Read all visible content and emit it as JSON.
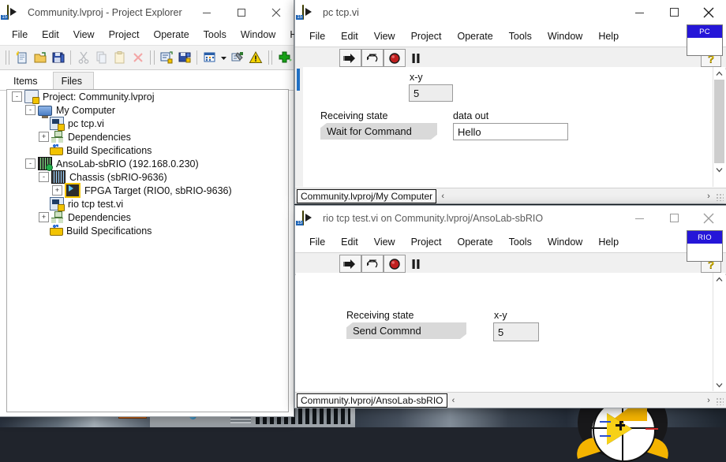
{
  "desktop": {
    "logo_name": "labview-tux-logo"
  },
  "project_explorer": {
    "title": "Community.lvproj - Project Explorer",
    "app_icon": "labview-project-icon",
    "window_buttons": {
      "minimize": "minimize-icon",
      "maximize": "maximize-icon",
      "close": "close-icon"
    },
    "menu": [
      "File",
      "Edit",
      "View",
      "Project",
      "Operate",
      "Tools",
      "Window",
      "Help"
    ],
    "toolbar_icons": [
      "new-vi-icon",
      "open-project-icon",
      "save-all-icon",
      "cut-icon",
      "copy-icon",
      "paste-icon",
      "delete-icon",
      "show-block-diagram-icon",
      "save-changed-icon",
      "view-options-icon",
      "view-options-dropdown-icon",
      "resolve-conflicts-icon",
      "warning-icon",
      "add-item-icon"
    ],
    "tabs": [
      {
        "label": "Items",
        "active": true
      },
      {
        "label": "Files",
        "active": false
      }
    ],
    "tree": [
      {
        "label": "Project: Community.lvproj",
        "depth": 0,
        "expander": "-",
        "icon": "project-icon"
      },
      {
        "label": "My Computer",
        "depth": 1,
        "expander": "-",
        "icon": "my-computer-icon"
      },
      {
        "label": "pc tcp.vi",
        "depth": 2,
        "expander": "",
        "icon": "vi-icon"
      },
      {
        "label": "Dependencies",
        "depth": 2,
        "expander": "+",
        "icon": "dependencies-icon"
      },
      {
        "label": "Build Specifications",
        "depth": 2,
        "expander": "",
        "icon": "build-specifications-icon"
      },
      {
        "label": "AnsoLab-sbRIO (192.168.0.230)",
        "depth": 1,
        "expander": "-",
        "icon": "rio-target-icon"
      },
      {
        "label": "Chassis (sbRIO-9636)",
        "depth": 2,
        "expander": "-",
        "icon": "chassis-icon"
      },
      {
        "label": "FPGA Target (RIO0, sbRIO-9636)",
        "depth": 3,
        "expander": "+",
        "icon": "fpga-target-icon"
      },
      {
        "label": "rio tcp test.vi",
        "depth": 2,
        "expander": "",
        "icon": "vi-icon"
      },
      {
        "label": "Dependencies",
        "depth": 2,
        "expander": "+",
        "icon": "dependencies-icon"
      },
      {
        "label": "Build Specifications",
        "depth": 2,
        "expander": "",
        "icon": "build-specifications-icon"
      }
    ]
  },
  "pc_vi": {
    "title": "pc tcp.vi",
    "app_icon": "labview-vi-icon",
    "active": true,
    "menu": [
      "File",
      "Edit",
      "View",
      "Project",
      "Operate",
      "Tools",
      "Window",
      "Help"
    ],
    "toolbar": {
      "run_icon": "run-arrow-icon",
      "run_continuously_icon": "run-continuously-icon",
      "abort_icon": "abort-execution-icon",
      "pause_icon": "pause-icon",
      "help_icon": "context-help-icon"
    },
    "badge": {
      "label": "PC",
      "color": "#2516d8"
    },
    "controls": {
      "xy_label": "x-y",
      "xy_value": "5",
      "state_label": "Receiving state",
      "state_value": "Wait for Command",
      "dataout_label": "data out",
      "dataout_value": "Hello"
    },
    "status_path": "Community.lvproj/My Computer",
    "scroll_left_icon": "scroll-left-icon",
    "scroll_right_icon": "scroll-right-icon"
  },
  "rio_vi": {
    "title": "rio tcp test.vi on Community.lvproj/AnsoLab-sbRIO",
    "app_icon": "labview-vi-icon",
    "active": false,
    "menu": [
      "File",
      "Edit",
      "View",
      "Project",
      "Operate",
      "Tools",
      "Window",
      "Help"
    ],
    "toolbar": {
      "run_icon": "run-arrow-icon",
      "run_continuously_icon": "run-continuously-icon",
      "abort_icon": "abort-execution-icon",
      "pause_icon": "pause-icon",
      "help_icon": "context-help-icon"
    },
    "badge": {
      "label": "RIO",
      "color": "#2516d8"
    },
    "controls": {
      "state_label": "Receiving state",
      "state_value": "Send Commnd",
      "xy_label": "x-y",
      "xy_value": "5"
    },
    "status_path": "Community.lvproj/AnsoLab-sbRIO",
    "scroll_left_icon": "scroll-left-icon",
    "scroll_right_icon": "scroll-right-icon"
  }
}
